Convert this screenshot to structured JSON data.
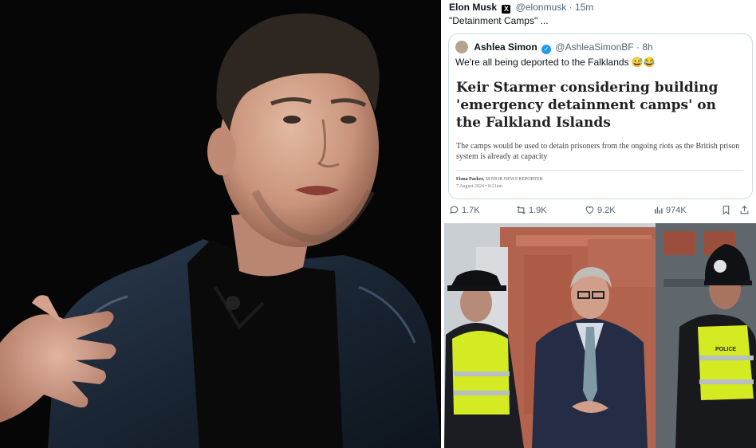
{
  "tweet": {
    "author_name": "Elon Musk",
    "handle": "@elonmusk",
    "time": "15m",
    "text": "\"Detainment Camps\" ..."
  },
  "quote": {
    "author_name": "Ashlea Simon",
    "handle": "@AshleaSimonBF",
    "time": "8h",
    "text": "We're all being deported to the Falklands 😅😂"
  },
  "article": {
    "headline": "Keir Starmer considering building 'emergency detainment camps' on the Falkland Islands",
    "standfirst": "The camps would be used to detain prisoners from the ongoing riots as the British prison system is already at capacity",
    "byline_name": "Fiona Parker,",
    "byline_role": "SENIOR NEWS REPORTER",
    "date": "7 August 2024 • 8:21am"
  },
  "actions": {
    "replies": "1.7K",
    "reposts": "1.9K",
    "likes": "9.2K",
    "views": "974K"
  },
  "police_badge": "POLICE",
  "colors": {
    "verified": "#1d9bf0",
    "text": "#0f1419",
    "muted": "#536471",
    "hi_vis": "#d8ef1e"
  }
}
